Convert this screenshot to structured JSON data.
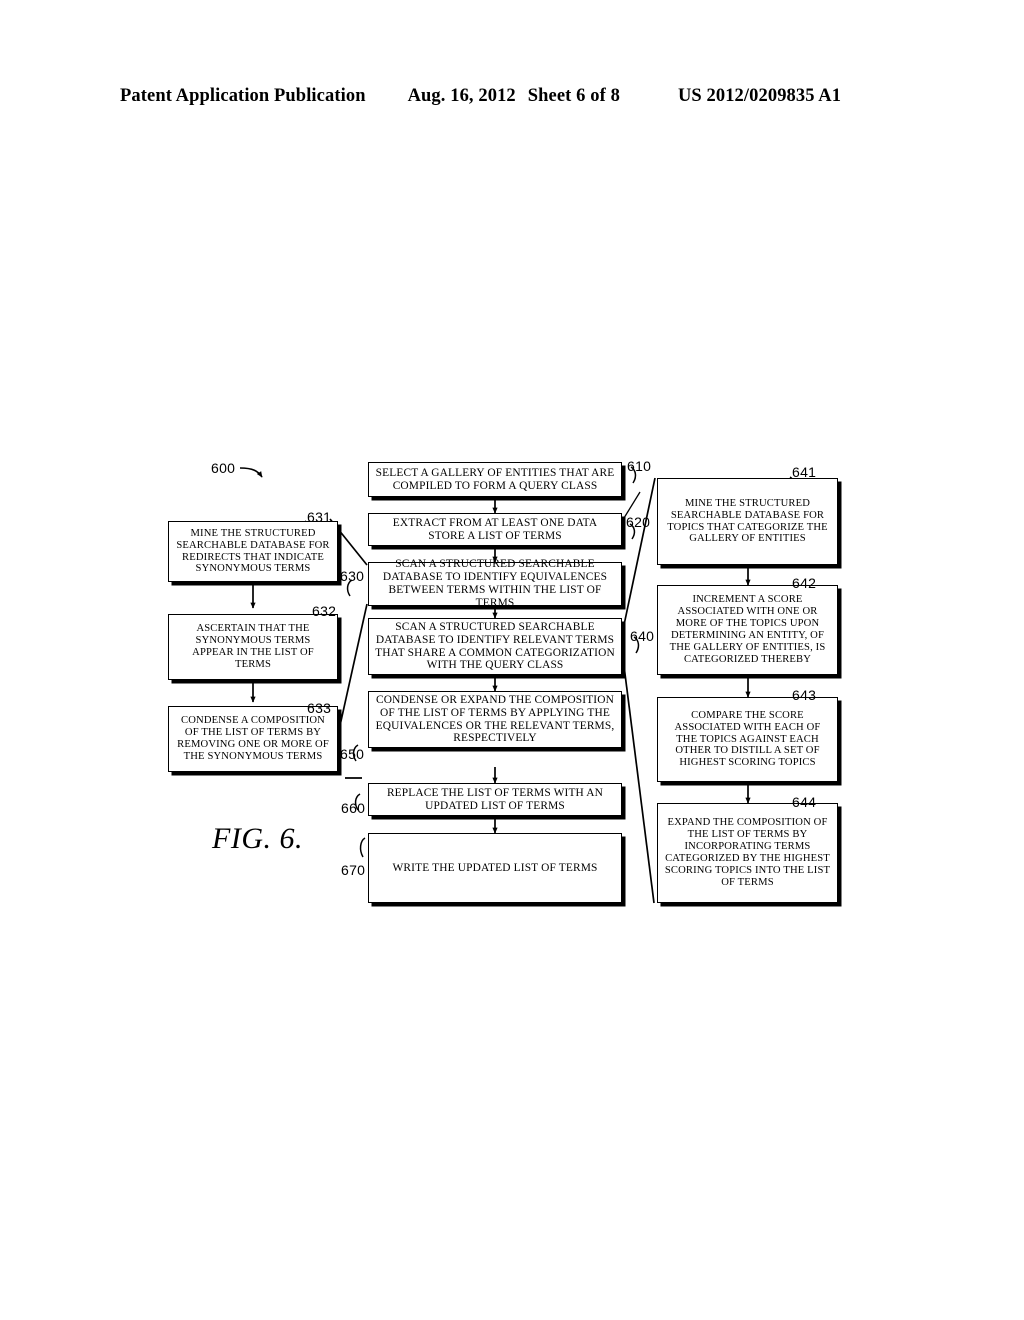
{
  "header": {
    "title": "Patent Application Publication",
    "date": "Aug. 16, 2012",
    "sheet": "Sheet 6 of 8",
    "publication_number": "US 2012/0209835 A1"
  },
  "figure": {
    "caption": "FIG. 6.",
    "diagram_label": "600",
    "main_flow": [
      {
        "ref": "610",
        "text": "SELECT A GALLERY OF ENTITIES THAT ARE COMPILED TO FORM A QUERY CLASS"
      },
      {
        "ref": "620",
        "text": "EXTRACT FROM AT LEAST ONE DATA STORE A LIST OF TERMS"
      },
      {
        "ref": "630",
        "text": "SCAN A STRUCTURED SEARCHABLE DATABASE TO IDENTIFY EQUIVALENCES BETWEEN TERMS WITHIN THE LIST OF TERMS"
      },
      {
        "ref": "640",
        "text": "SCAN A STRUCTURED SEARCHABLE DATABASE TO IDENTIFY RELEVANT TERMS THAT SHARE A COMMON CATEGORIZATION WITH THE QUERY CLASS"
      },
      {
        "ref": "650",
        "text": "CONDENSE OR EXPAND THE COMPOSITION OF THE LIST OF TERMS BY APPLYING THE EQUIVALENCES OR THE RELEVANT TERMS, RESPECTIVELY"
      },
      {
        "ref": "660",
        "text": "REPLACE THE LIST OF TERMS WITH AN UPDATED LIST OF TERMS"
      },
      {
        "ref": "670",
        "text": "WRITE THE UPDATED LIST OF TERMS"
      }
    ],
    "left_branch": [
      {
        "ref": "631",
        "text": "MINE THE STRUCTURED SEARCHABLE DATABASE FOR REDIRECTS THAT INDICATE SYNONYMOUS TERMS"
      },
      {
        "ref": "632",
        "text": "ASCERTAIN THAT THE SYNONYMOUS TERMS APPEAR IN THE LIST OF TERMS"
      },
      {
        "ref": "633",
        "text": "CONDENSE A COMPOSITION OF THE LIST OF TERMS BY REMOVING ONE OR MORE OF THE SYNONYMOUS TERMS"
      }
    ],
    "right_branch": [
      {
        "ref": "641",
        "text": "MINE THE STRUCTURED SEARCHABLE DATABASE FOR TOPICS THAT CATEGORIZE THE GALLERY OF ENTITIES"
      },
      {
        "ref": "642",
        "text": "INCREMENT A SCORE ASSOCIATED WITH ONE OR MORE OF THE TOPICS UPON DETERMINING AN ENTITY, OF THE GALLERY OF ENTITIES, IS CATEGORIZED THEREBY"
      },
      {
        "ref": "643",
        "text": "COMPARE THE SCORE ASSOCIATED WITH EACH OF THE TOPICS AGAINST EACH OTHER TO DISTILL A SET OF HIGHEST SCORING TOPICS"
      },
      {
        "ref": "644",
        "text": "EXPAND THE COMPOSITION OF THE LIST OF TERMS BY INCORPORATING TERMS CATEGORIZED BY THE HIGHEST SCORING TOPICS INTO THE LIST OF TERMS"
      }
    ]
  }
}
